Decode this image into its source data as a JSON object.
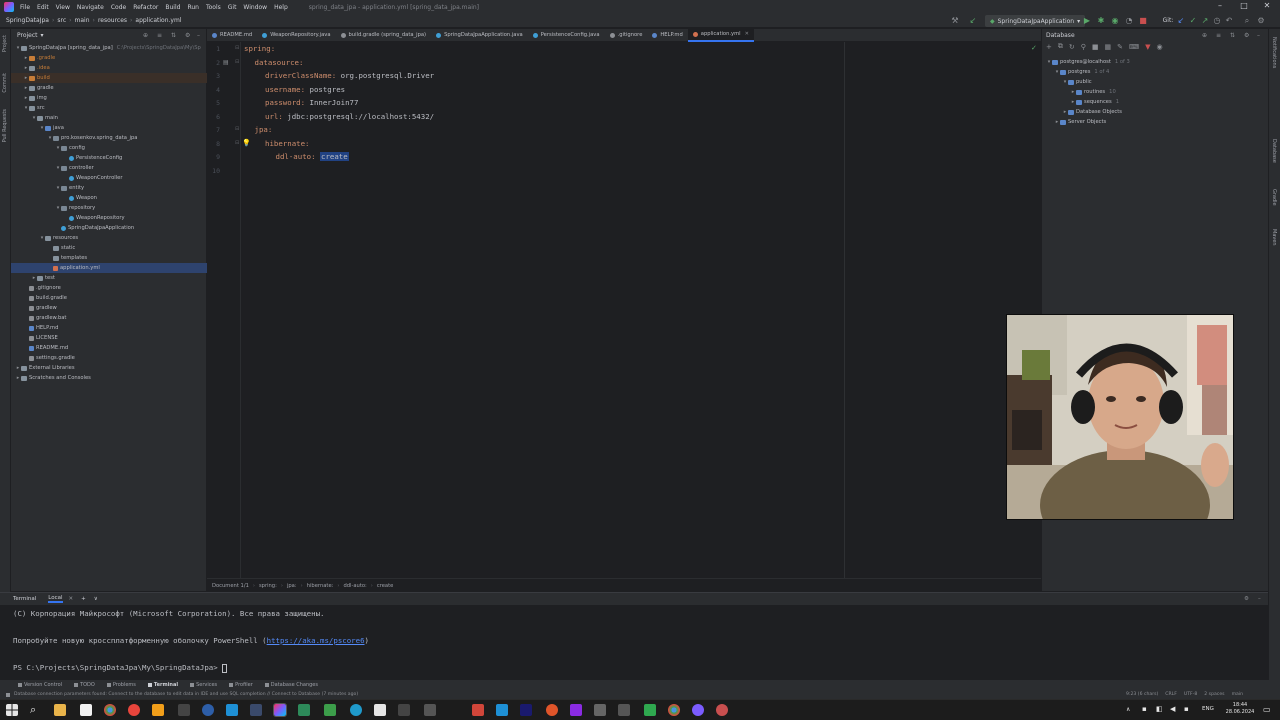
{
  "menubar": {
    "items": [
      "File",
      "Edit",
      "View",
      "Navigate",
      "Code",
      "Refactor",
      "Build",
      "Run",
      "Tools",
      "Git",
      "Window",
      "Help"
    ],
    "window_title": "spring_data_jpa - application.yml [spring_data_jpa.main]"
  },
  "navbar": {
    "crumbs": [
      "SpringDataJpa",
      "src",
      "main",
      "resources",
      "application.yml"
    ],
    "run_config": "SpringDataJpaApplication",
    "git_label": "Git:"
  },
  "left_strip": {
    "labels": [
      "Project",
      "Commit",
      "Pull Requests"
    ]
  },
  "project_panel": {
    "title": "Project",
    "tree": [
      {
        "label": "SpringDataJpa [spring_data_jpa]",
        "suffix": "C:\\Projects\\SpringDataJpa\\My\\Sp",
        "indent": 0,
        "icon": "folder",
        "toggle": "▾"
      },
      {
        "label": ".gradle",
        "indent": 1,
        "icon": "orange",
        "toggle": "▸",
        "cls": "excluded"
      },
      {
        "label": ".idea",
        "indent": 1,
        "icon": "folder",
        "toggle": "▸",
        "cls": "excluded"
      },
      {
        "label": "build",
        "indent": 1,
        "icon": "orange",
        "toggle": "▸",
        "cls": "excluded build"
      },
      {
        "label": "gradle",
        "indent": 1,
        "icon": "folder",
        "toggle": "▸"
      },
      {
        "label": "img",
        "indent": 1,
        "icon": "folder",
        "toggle": "▸"
      },
      {
        "label": "src",
        "indent": 1,
        "icon": "folder",
        "toggle": "▾"
      },
      {
        "label": "main",
        "indent": 2,
        "icon": "folder",
        "toggle": "▾"
      },
      {
        "label": "java",
        "indent": 3,
        "icon": "src",
        "toggle": "▾"
      },
      {
        "label": "pro.kosenkov.spring_data_jpa",
        "indent": 4,
        "icon": "pkg",
        "toggle": "▾"
      },
      {
        "label": "config",
        "indent": 5,
        "icon": "pkg",
        "toggle": "▾"
      },
      {
        "label": "PersistenceConfig",
        "indent": 6,
        "icon": "cls",
        "toggle": ""
      },
      {
        "label": "controller",
        "indent": 5,
        "icon": "pkg",
        "toggle": "▾"
      },
      {
        "label": "WeaponController",
        "indent": 6,
        "icon": "cls",
        "toggle": ""
      },
      {
        "label": "entity",
        "indent": 5,
        "icon": "pkg",
        "toggle": "▾"
      },
      {
        "label": "Weapon",
        "indent": 6,
        "icon": "cls",
        "toggle": ""
      },
      {
        "label": "repository",
        "indent": 5,
        "icon": "pkg",
        "toggle": "▾"
      },
      {
        "label": "WeaponRepository",
        "indent": 6,
        "icon": "cls",
        "toggle": ""
      },
      {
        "label": "SpringDataJpaApplication",
        "indent": 5,
        "icon": "cls",
        "toggle": ""
      },
      {
        "label": "resources",
        "indent": 3,
        "icon": "folder",
        "toggle": "▾"
      },
      {
        "label": "static",
        "indent": 4,
        "icon": "folder",
        "toggle": ""
      },
      {
        "label": "templates",
        "indent": 4,
        "icon": "folder",
        "toggle": ""
      },
      {
        "label": "application.yml",
        "indent": 4,
        "icon": "yml",
        "toggle": "",
        "selected": true
      },
      {
        "label": "test",
        "indent": 2,
        "icon": "folder",
        "toggle": "▸"
      },
      {
        "label": ".gitignore",
        "indent": 1,
        "icon": "file",
        "toggle": ""
      },
      {
        "label": "build.gradle",
        "indent": 1,
        "icon": "file",
        "toggle": ""
      },
      {
        "label": "gradlew",
        "indent": 1,
        "icon": "file",
        "toggle": ""
      },
      {
        "label": "gradlew.bat",
        "indent": 1,
        "icon": "file",
        "toggle": ""
      },
      {
        "label": "HELP.md",
        "indent": 1,
        "icon": "md",
        "toggle": ""
      },
      {
        "label": "LICENSE",
        "indent": 1,
        "icon": "file",
        "toggle": ""
      },
      {
        "label": "README.md",
        "indent": 1,
        "icon": "md",
        "toggle": ""
      },
      {
        "label": "settings.gradle",
        "indent": 1,
        "icon": "file",
        "toggle": ""
      },
      {
        "label": "External Libraries",
        "indent": 0,
        "icon": "folder",
        "toggle": "▸"
      },
      {
        "label": "Scratches and Consoles",
        "indent": 0,
        "icon": "folder",
        "toggle": "▸"
      }
    ]
  },
  "editor": {
    "tabs": [
      {
        "label": "README.md",
        "color": "#5a86c9"
      },
      {
        "label": "WeaponRepository.java",
        "color": "#3f9fd6"
      },
      {
        "label": "build.gradle (spring_data_jpa)",
        "color": "#8c8f94"
      },
      {
        "label": "SpringDataJpaApplication.java",
        "color": "#3f9fd6"
      },
      {
        "label": "PersistenceConfig.java",
        "color": "#3f9fd6"
      },
      {
        "label": ".gitignore",
        "color": "#8c8f94"
      },
      {
        "label": "HELP.md",
        "color": "#5a86c9"
      },
      {
        "label": "application.yml",
        "color": "#d1704f",
        "active": true
      }
    ],
    "lines": [
      {
        "num": "1",
        "indent": 0,
        "key": "spring:",
        "value": ""
      },
      {
        "num": "2",
        "indent": 1,
        "key": "datasource:",
        "value": ""
      },
      {
        "num": "3",
        "indent": 2,
        "key": "driverClassName:",
        "value": " org.postgresql.Driver"
      },
      {
        "num": "4",
        "indent": 2,
        "key": "username:",
        "value": " postgres"
      },
      {
        "num": "5",
        "indent": 2,
        "key": "password:",
        "value": " InnerJoin77"
      },
      {
        "num": "6",
        "indent": 2,
        "key": "url:",
        "value": " jdbc:postgresql://localhost:5432/"
      },
      {
        "num": "7",
        "indent": 1,
        "key": "jpa:",
        "value": ""
      },
      {
        "num": "8",
        "indent": 2,
        "key": "hibernate:",
        "value": ""
      },
      {
        "num": "9",
        "indent": 3,
        "key": "ddl-auto:",
        "value": "",
        "highlight": "create"
      },
      {
        "num": "10",
        "indent": 0,
        "key": "",
        "value": ""
      }
    ],
    "breadcrumb": [
      "Document 1/1",
      "spring:",
      "jpa:",
      "hibernate:",
      "ddl-auto:",
      "create"
    ]
  },
  "database_panel": {
    "title": "Database",
    "tree": [
      {
        "label": "postgres@localhost",
        "suffix": "1 of 3",
        "indent": 0,
        "toggle": "▾"
      },
      {
        "label": "postgres",
        "suffix": "1 of 4",
        "indent": 1,
        "toggle": "▾"
      },
      {
        "label": "public",
        "indent": 2,
        "toggle": "▾"
      },
      {
        "label": "routines",
        "suffix": "10",
        "indent": 3,
        "toggle": "▸"
      },
      {
        "label": "sequences",
        "suffix": "1",
        "indent": 3,
        "toggle": "▸"
      },
      {
        "label": "Database Objects",
        "indent": 2,
        "toggle": "▸"
      },
      {
        "label": "Server Objects",
        "indent": 1,
        "toggle": "▸"
      }
    ]
  },
  "right_strip": {
    "labels": [
      "Notifications",
      "Database",
      "Gradle",
      "Maven"
    ]
  },
  "terminal": {
    "header": [
      "Terminal",
      "Local",
      "+",
      "∨"
    ],
    "lines": [
      {
        "text": "(С) Корпорация Майкрософт (Microsoft Corporation). Все права защищены."
      },
      {
        "text": ""
      },
      {
        "text": "Попробуйте новую кроссплатформенную оболочку PowerShell (",
        "link": "https://aka.ms/pscore6",
        "after": ")"
      },
      {
        "text": ""
      },
      {
        "text": "PS C:\\Projects\\SpringDataJpa\\My\\SpringDataJpa> "
      }
    ]
  },
  "bottom_tools": [
    "Version Control",
    "TODO",
    "Problems",
    "Terminal",
    "Services",
    "Profiler",
    "Database Changes"
  ],
  "active_bottom_tool": "Terminal",
  "statusbar": {
    "message": "Database connection parameters found: Connect to the database to edit data in IDE and use SQL completion // Connect to Database (7 minutes ago)",
    "right": [
      "9:23 (6 chars)",
      "CRLF",
      "UTF-8",
      "2 spaces",
      "main"
    ]
  },
  "taskbar": {
    "time": "18:44",
    "date": "28.06.2024",
    "lang": "ENG"
  },
  "colors": {
    "accent": "#3574f0",
    "keyword": "#cf8e6d",
    "selection": "#214283"
  }
}
